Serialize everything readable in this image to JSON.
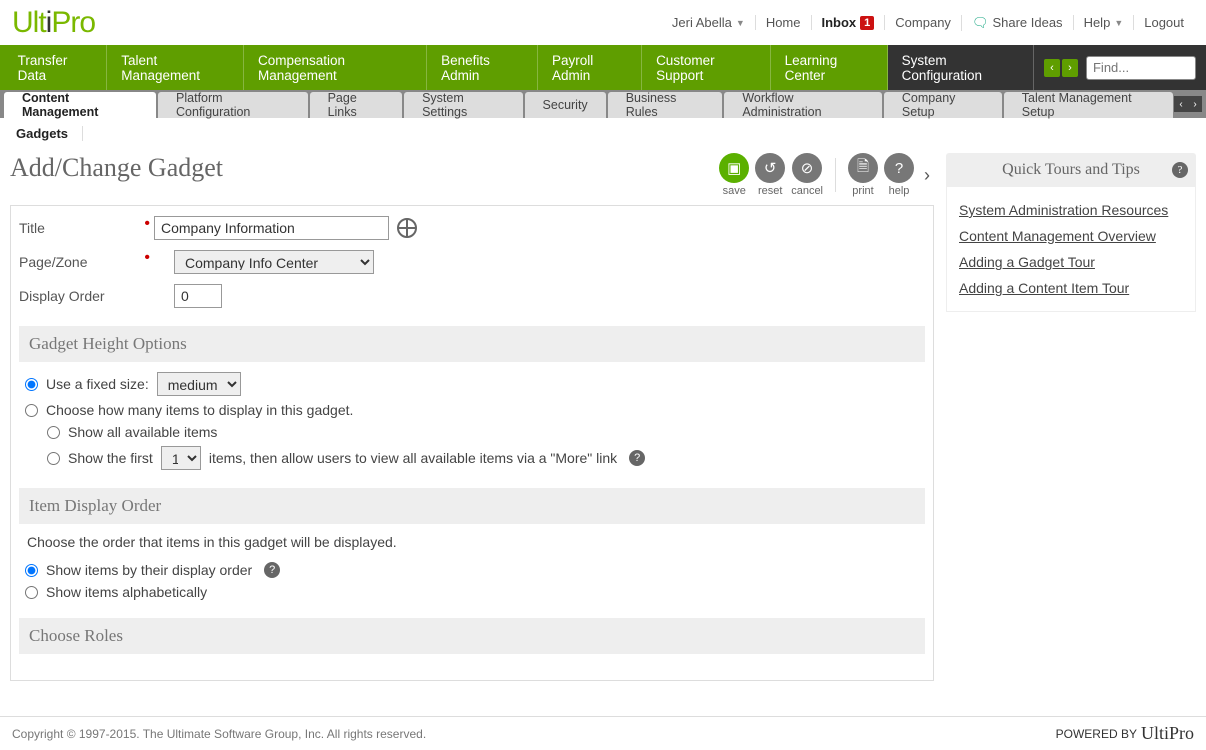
{
  "top": {
    "user": "Jeri Abella",
    "home": "Home",
    "inbox": "Inbox",
    "inbox_count": "1",
    "company": "Company",
    "share": "Share Ideas",
    "help": "Help",
    "logout": "Logout"
  },
  "nav": {
    "items": [
      "Transfer Data",
      "Talent Management",
      "Compensation Management",
      "Benefits Admin",
      "Payroll Admin",
      "Customer Support",
      "Learning Center",
      "System Configuration"
    ],
    "find_placeholder": "Find..."
  },
  "subnav": {
    "items": [
      "Content Management",
      "Platform Configuration",
      "Page Links",
      "System Settings",
      "Security",
      "Business Rules",
      "Workflow Administration",
      "Company Setup",
      "Talent Management Setup"
    ]
  },
  "context": {
    "gadgets": "Gadgets"
  },
  "page": {
    "title": "Add/Change Gadget"
  },
  "actions": {
    "save": "save",
    "reset": "reset",
    "cancel": "cancel",
    "print": "print",
    "help": "help"
  },
  "form": {
    "title_label": "Title",
    "title_value": "Company Information",
    "pagezone_label": "Page/Zone",
    "pagezone_value": "Company Info Center",
    "displayorder_label": "Display Order",
    "displayorder_value": "0",
    "height_heading": "Gadget Height Options",
    "fixed_label": "Use a fixed size:",
    "fixed_value": "medium",
    "choose_items_label": "Choose how many items to display in this gadget.",
    "show_all": "Show all available items",
    "show_first_a": "Show the first",
    "show_first_count": "1",
    "show_first_b": "items, then allow users to view all available items via a \"More\" link",
    "item_order_heading": "Item Display Order",
    "item_order_desc": "Choose the order that items in this gadget will be displayed.",
    "order_by_display": "Show items by their display order",
    "order_alpha": "Show items alphabetically",
    "roles_heading": "Choose Roles"
  },
  "side": {
    "heading": "Quick Tours and Tips",
    "links": [
      "System Administration Resources",
      "Content Management Overview",
      "Adding a Gadget Tour",
      "Adding a Content Item Tour"
    ]
  },
  "footer": {
    "copy": "Copyright © 1997-2015. The Ultimate Software Group, Inc. All rights reserved.",
    "powered": "POWERED BY"
  }
}
